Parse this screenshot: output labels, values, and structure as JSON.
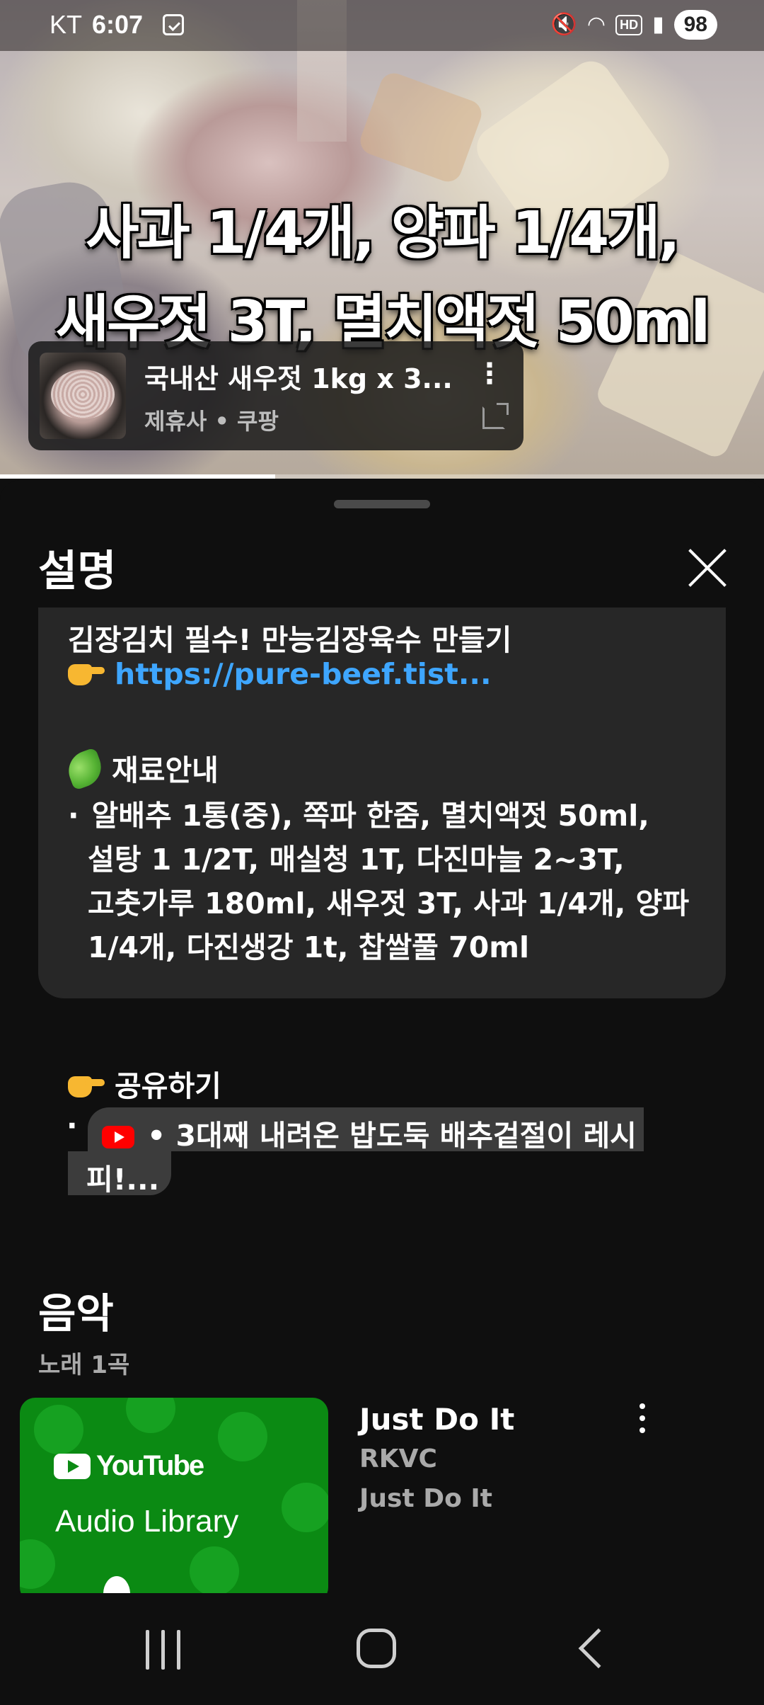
{
  "status_bar": {
    "carrier": "KT",
    "time": "6:07",
    "hd": "HD",
    "battery": "98"
  },
  "video": {
    "overlay_line1": "사과 1/4개, 양파 1/4개,",
    "overlay_line2": "새우젓 3T, 멸치액젓 50ml",
    "progress_fraction": 0.36,
    "product": {
      "title": "국내산 새우젓 1kg x 3...",
      "subtitle": "제휴사 • 쿠팡"
    }
  },
  "sheet": {
    "title": "설명",
    "description": {
      "line_promo": "김장김치 필수! 만능김장육수 만들기",
      "link": "https://pure-beef.tist...",
      "ingredients_heading": "재료안내",
      "ingredients_1": "알배추 1통(중), 쪽파 한줌, 멸치액젓 50ml,",
      "ingredients_2": "설탕 1 1/2T, 매실청 1T, 다진마늘 2~3T,",
      "ingredients_3": "고춧가루 180ml, 새우젓 3T, 사과 1/4개, 양파",
      "ingredients_4": "1/4개, 다진생강 1t, 찹쌀풀 70ml",
      "share_heading": "공유하기",
      "share_chip_1": "• 3대째 내려온 밥도둑 배추겉절이 레시",
      "share_chip_2": "피!..."
    },
    "music": {
      "title": "음악",
      "subtitle": "노래 1곡",
      "album_brand": "YouTube",
      "album_lib": "Audio Library",
      "track": {
        "title": "Just Do It",
        "artist": "RKVC",
        "album": "Just Do It"
      }
    }
  },
  "colors": {
    "link": "#3ea6ff",
    "sheet_bg": "#0f0f0f",
    "desc_bg": "#272727",
    "album_green": "#0b8a13"
  }
}
